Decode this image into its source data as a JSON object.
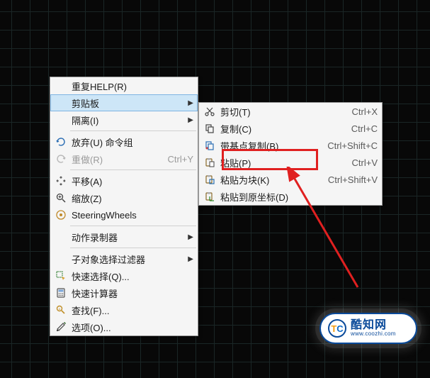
{
  "main_menu": {
    "repeat": "重复HELP(R)",
    "clipboard": "剪贴板",
    "isolate": "隔离(I)",
    "undo": "放弃(U) 命令组",
    "redo": "重做(R)",
    "redo_shortcut": "Ctrl+Y",
    "pan": "平移(A)",
    "zoom": "缩放(Z)",
    "steering": "SteeringWheels",
    "action_recorder": "动作录制器",
    "subobject_filter": "子对象选择过滤器",
    "quick_select": "快速选择(Q)...",
    "quick_calc": "快速计算器",
    "find": "查找(F)...",
    "options": "选项(O)..."
  },
  "sub_menu": {
    "cut": {
      "label": "剪切(T)",
      "shortcut": "Ctrl+X"
    },
    "copy": {
      "label": "复制(C)",
      "shortcut": "Ctrl+C"
    },
    "copy_base": {
      "label": "带基点复制(B)",
      "shortcut": "Ctrl+Shift+C"
    },
    "paste": {
      "label": "粘贴(P)",
      "shortcut": "Ctrl+V"
    },
    "paste_block": {
      "label": "粘贴为块(K)",
      "shortcut": "Ctrl+Shift+V"
    },
    "paste_orig": {
      "label": "粘贴到原坐标(D)",
      "shortcut": ""
    }
  },
  "watermark": {
    "cn": "酷知网",
    "en": "www.coozhi.com"
  }
}
